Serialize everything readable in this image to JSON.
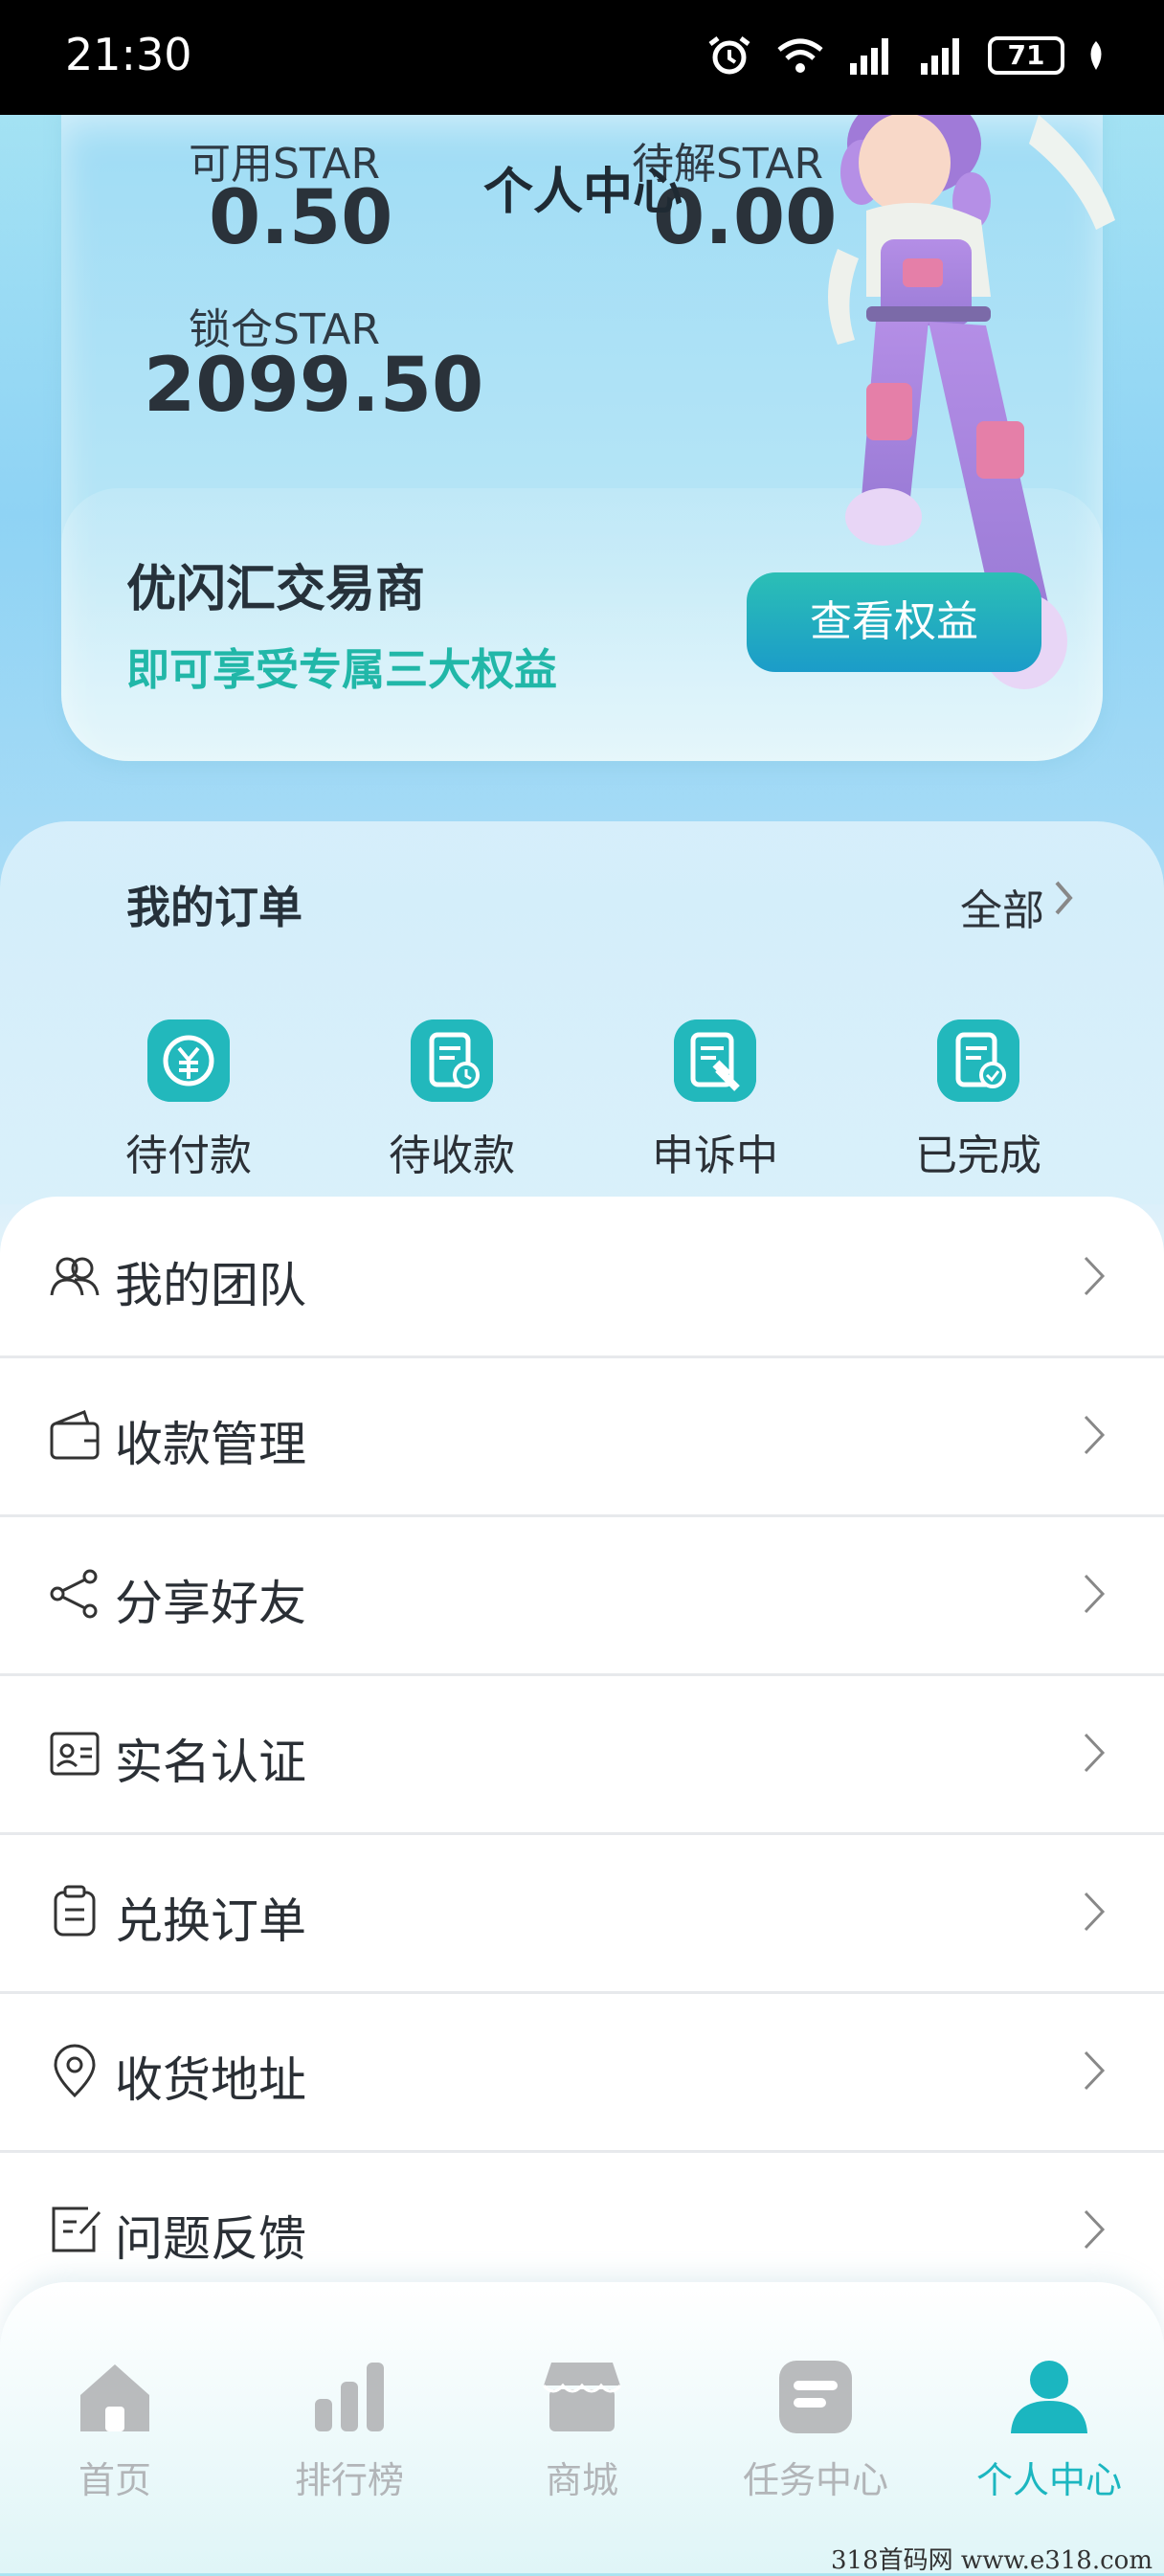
{
  "status_bar": {
    "time": "21:30",
    "battery": "71"
  },
  "page_title": "个人中心",
  "balances": {
    "available_label": "可用STAR",
    "available_value": "0.50",
    "pending_label": "待解STAR",
    "pending_value": "0.00",
    "locked_label": "锁仓STAR",
    "locked_value": "2099.50"
  },
  "merchant": {
    "title": "优闪汇交易商",
    "subtitle": "即可享受专属三大权益",
    "button": "查看权益"
  },
  "orders": {
    "title": "我的订单",
    "all": "全部",
    "items": [
      {
        "label": "待付款",
        "icon": "pay-icon"
      },
      {
        "label": "待收款",
        "icon": "receive-icon"
      },
      {
        "label": "申诉中",
        "icon": "appeal-icon"
      },
      {
        "label": "已完成",
        "icon": "done-icon"
      }
    ]
  },
  "menu": [
    {
      "label": "我的团队",
      "icon": "team-icon"
    },
    {
      "label": "收款管理",
      "icon": "wallet-icon"
    },
    {
      "label": "分享好友",
      "icon": "share-icon"
    },
    {
      "label": "实名认证",
      "icon": "id-card-icon"
    },
    {
      "label": "兑换订单",
      "icon": "clipboard-icon"
    },
    {
      "label": "收货地址",
      "icon": "location-icon"
    },
    {
      "label": "问题反馈",
      "icon": "feedback-icon"
    }
  ],
  "nav": [
    {
      "label": "首页",
      "icon": "home-icon"
    },
    {
      "label": "排行榜",
      "icon": "ranking-icon"
    },
    {
      "label": "商城",
      "icon": "shop-icon"
    },
    {
      "label": "任务中心",
      "icon": "task-icon"
    },
    {
      "label": "个人中心",
      "icon": "profile-icon",
      "active": true
    }
  ],
  "colors": {
    "accent": "#1bb6c0",
    "button_start": "#2bbfb5",
    "button_end": "#1b9cc9"
  },
  "watermark": "318首码网 www.e318.com"
}
